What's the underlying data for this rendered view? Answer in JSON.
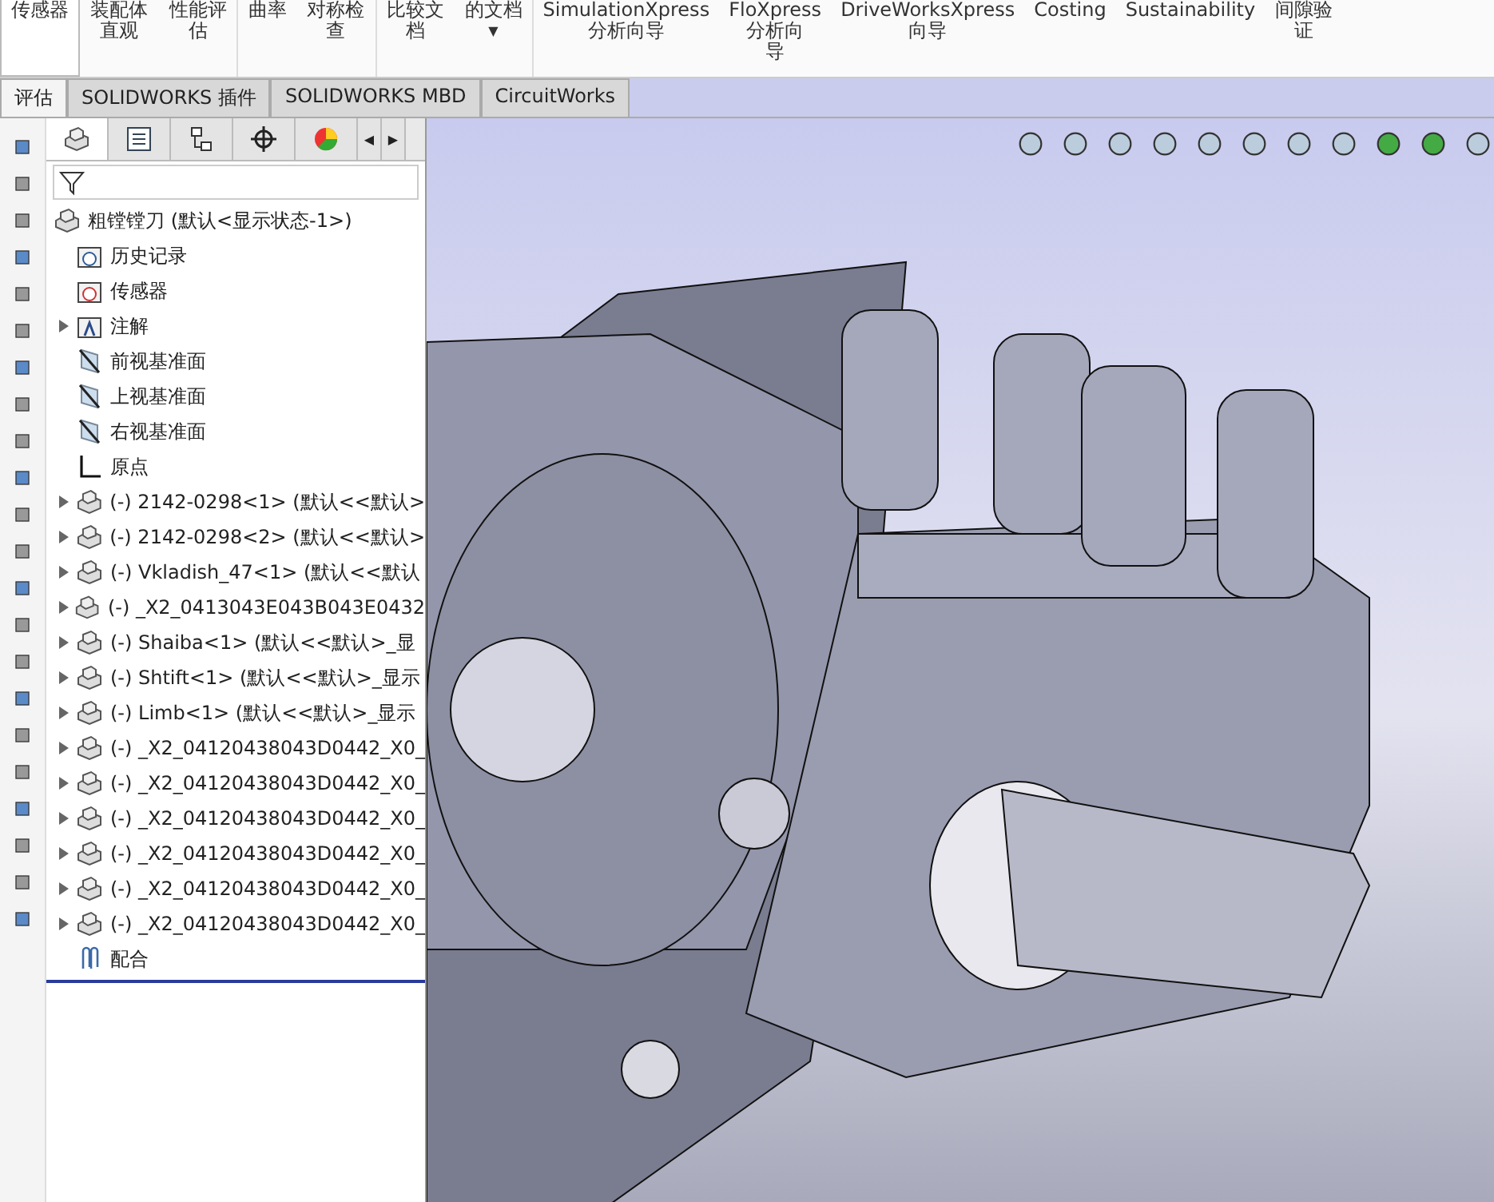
{
  "ribbon": {
    "items": [
      {
        "label": "传感器",
        "selected": true
      },
      {
        "label": "装配体直观",
        "selected": false
      },
      {
        "label": "性能评估",
        "selected": false
      },
      {
        "label": "曲率",
        "selected": false
      },
      {
        "label": "对称检查",
        "selected": false
      },
      {
        "label": "比较文档",
        "selected": false
      },
      {
        "label": "的文档",
        "selected": false,
        "caret": "▼"
      },
      {
        "label": "SimulationXpress\n分析向导",
        "selected": false
      },
      {
        "label": "FloXpress\n分析向导",
        "selected": false
      },
      {
        "label": "DriveWorksXpress\n向导",
        "selected": false
      },
      {
        "label": "Costing",
        "selected": false
      },
      {
        "label": "Sustainability",
        "selected": false
      },
      {
        "label": "间隙验证",
        "selected": false
      }
    ]
  },
  "tabs": [
    {
      "label": "评估",
      "selected": true
    },
    {
      "label": "SOLIDWORKS 插件",
      "selected": false
    },
    {
      "label": "SOLIDWORKS MBD",
      "selected": false
    },
    {
      "label": "CircuitWorks",
      "selected": false
    }
  ],
  "tab_scroll": [
    "◀",
    "▶"
  ],
  "manager_tabs": [
    {
      "kind": "feature",
      "selected": true
    },
    {
      "kind": "property",
      "selected": false
    },
    {
      "kind": "config",
      "selected": false
    },
    {
      "kind": "dim",
      "selected": false
    },
    {
      "kind": "display",
      "selected": false
    }
  ],
  "tree": {
    "root": "粗镗镗刀 (默认<显示状态-1>)",
    "items": [
      {
        "kind": "history",
        "label": "历史记录",
        "expandable": false
      },
      {
        "kind": "sensor",
        "label": "传感器",
        "expandable": false
      },
      {
        "kind": "annotation",
        "label": "注解",
        "expandable": true
      },
      {
        "kind": "plane",
        "label": "前视基准面",
        "expandable": false
      },
      {
        "kind": "plane",
        "label": "上视基准面",
        "expandable": false
      },
      {
        "kind": "plane",
        "label": "右视基准面",
        "expandable": false
      },
      {
        "kind": "origin",
        "label": "原点",
        "expandable": false
      },
      {
        "kind": "part",
        "label": "(-) 2142-0298<1> (默认<<默认>",
        "expandable": true
      },
      {
        "kind": "part",
        "label": "(-) 2142-0298<2> (默认<<默认>",
        "expandable": true
      },
      {
        "kind": "part",
        "label": "(-) Vkladish_47<1> (默认<<默认",
        "expandable": true
      },
      {
        "kind": "part",
        "label": "(-) _X2_0413043E043B043E0432",
        "expandable": true
      },
      {
        "kind": "part",
        "label": "(-) Shaiba<1> (默认<<默认>_显",
        "expandable": true
      },
      {
        "kind": "part",
        "label": "(-) Shtift<1> (默认<<默认>_显示",
        "expandable": true
      },
      {
        "kind": "part",
        "label": "(-) Limb<1> (默认<<默认>_显示",
        "expandable": true
      },
      {
        "kind": "part",
        "label": "(-) _X2_04120438043D0442_X0_",
        "expandable": true
      },
      {
        "kind": "part",
        "label": "(-) _X2_04120438043D0442_X0_",
        "expandable": true
      },
      {
        "kind": "part",
        "label": "(-) _X2_04120438043D0442_X0_",
        "expandable": true
      },
      {
        "kind": "part",
        "label": "(-) _X2_04120438043D0442_X0_",
        "expandable": true
      },
      {
        "kind": "part",
        "label": "(-) _X2_04120438043D0442_X0_",
        "expandable": true
      },
      {
        "kind": "part",
        "label": "(-) _X2_04120438043D0442_X0_",
        "expandable": true
      },
      {
        "kind": "mates",
        "label": "配合",
        "expandable": false
      }
    ]
  }
}
